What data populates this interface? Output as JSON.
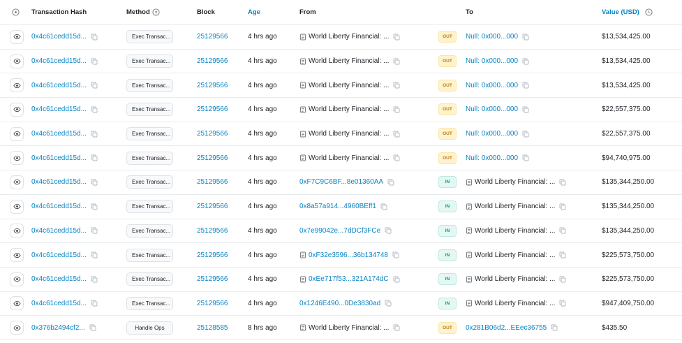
{
  "header": {
    "eye_col": "",
    "hash": "Transaction Hash",
    "method": "Method",
    "block": "Block",
    "age": "Age",
    "from": "From",
    "to": "To",
    "value": "Value (USD)"
  },
  "rows": [
    {
      "hash": "0x4c61cedd15d...",
      "method": "Exec Transac...",
      "block": "25129566",
      "age": "4 hrs ago",
      "from": "World Liberty Financial: ...",
      "from_type": "contract",
      "dir": "OUT",
      "to": "Null: 0x000...000",
      "to_type": "link",
      "value": "$13,534,425.00"
    },
    {
      "hash": "0x4c61cedd15d...",
      "method": "Exec Transac...",
      "block": "25129566",
      "age": "4 hrs ago",
      "from": "World Liberty Financial: ...",
      "from_type": "contract",
      "dir": "OUT",
      "to": "Null: 0x000...000",
      "to_type": "link",
      "value": "$13,534,425.00"
    },
    {
      "hash": "0x4c61cedd15d...",
      "method": "Exec Transac...",
      "block": "25129566",
      "age": "4 hrs ago",
      "from": "World Liberty Financial: ...",
      "from_type": "contract",
      "dir": "OUT",
      "to": "Null: 0x000...000",
      "to_type": "link",
      "value": "$13,534,425.00"
    },
    {
      "hash": "0x4c61cedd15d...",
      "method": "Exec Transac...",
      "block": "25129566",
      "age": "4 hrs ago",
      "from": "World Liberty Financial: ...",
      "from_type": "contract",
      "dir": "OUT",
      "to": "Null: 0x000...000",
      "to_type": "link",
      "value": "$22,557,375.00"
    },
    {
      "hash": "0x4c61cedd15d...",
      "method": "Exec Transac...",
      "block": "25129566",
      "age": "4 hrs ago",
      "from": "World Liberty Financial: ...",
      "from_type": "contract",
      "dir": "OUT",
      "to": "Null: 0x000...000",
      "to_type": "link",
      "value": "$22,557,375.00"
    },
    {
      "hash": "0x4c61cedd15d...",
      "method": "Exec Transac...",
      "block": "25129566",
      "age": "4 hrs ago",
      "from": "World Liberty Financial: ...",
      "from_type": "contract",
      "dir": "OUT",
      "to": "Null: 0x000...000",
      "to_type": "link",
      "value": "$94,740,975.00"
    },
    {
      "hash": "0x4c61cedd15d...",
      "method": "Exec Transac...",
      "block": "25129566",
      "age": "4 hrs ago",
      "from": "0xF7C9C6BF...8e01360AA",
      "from_type": "link",
      "dir": "IN",
      "to": "World Liberty Financial: ...",
      "to_type": "contract",
      "value": "$135,344,250.00"
    },
    {
      "hash": "0x4c61cedd15d...",
      "method": "Exec Transac...",
      "block": "25129566",
      "age": "4 hrs ago",
      "from": "0x8a57a914...4960BEff1",
      "from_type": "link",
      "dir": "IN",
      "to": "World Liberty Financial: ...",
      "to_type": "contract",
      "value": "$135,344,250.00"
    },
    {
      "hash": "0x4c61cedd15d...",
      "method": "Exec Transac...",
      "block": "25129566",
      "age": "4 hrs ago",
      "from": "0x7e99042e...7dDCf3FCe",
      "from_type": "link",
      "dir": "IN",
      "to": "World Liberty Financial: ...",
      "to_type": "contract",
      "value": "$135,344,250.00"
    },
    {
      "hash": "0x4c61cedd15d...",
      "method": "Exec Transac...",
      "block": "25129566",
      "age": "4 hrs ago",
      "from": "0xF32e3596...36b134748",
      "from_type": "contract-link",
      "dir": "IN",
      "to": "World Liberty Financial: ...",
      "to_type": "contract",
      "value": "$225,573,750.00"
    },
    {
      "hash": "0x4c61cedd15d...",
      "method": "Exec Transac...",
      "block": "25129566",
      "age": "4 hrs ago",
      "from": "0xEe717f53...321A174dC",
      "from_type": "contract-link",
      "dir": "IN",
      "to": "World Liberty Financial: ...",
      "to_type": "contract",
      "value": "$225,573,750.00"
    },
    {
      "hash": "0x4c61cedd15d...",
      "method": "Exec Transac...",
      "block": "25129566",
      "age": "4 hrs ago",
      "from": "0x1246E490...0De3830ad",
      "from_type": "link",
      "dir": "IN",
      "to": "World Liberty Financial: ...",
      "to_type": "contract",
      "value": "$947,409,750.00"
    },
    {
      "hash": "0x376b2494cf2...",
      "method": "Handle Ops",
      "block": "25128585",
      "age": "8 hrs ago",
      "from": "World Liberty Financial: ...",
      "from_type": "contract",
      "dir": "OUT",
      "to": "0x281B06d2...EEec36755",
      "to_type": "link",
      "value": "$435.50"
    }
  ],
  "colors": {
    "link": "#0784c3",
    "out_badge_bg": "#fff3cd",
    "in_badge_bg": "#e6f7f3"
  },
  "icons": {
    "eye": "eye-icon",
    "copy": "copy-icon",
    "doc": "contract-doc-icon",
    "info": "info-circle-icon",
    "clock": "clock-icon"
  }
}
